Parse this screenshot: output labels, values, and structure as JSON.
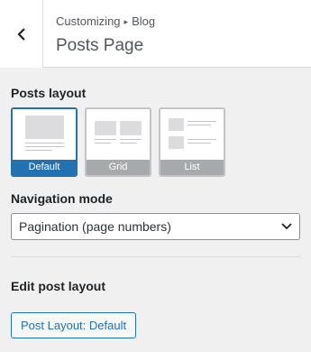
{
  "header": {
    "breadcrumb_parent": "Customizing",
    "breadcrumb_separator": "▸",
    "breadcrumb_current": "Blog",
    "title": "Posts Page"
  },
  "posts_layout": {
    "label": "Posts layout",
    "options": [
      {
        "label": "Default",
        "selected": true
      },
      {
        "label": "Grid",
        "selected": false
      },
      {
        "label": "List",
        "selected": false
      }
    ]
  },
  "navigation": {
    "label": "Navigation mode",
    "selected_value": "Pagination (page numbers)"
  },
  "post_layout": {
    "label": "Edit post layout",
    "button_label": "Post Layout: Default"
  },
  "colors": {
    "accent": "#2271b1",
    "background": "#f0f0f1",
    "inactive_caption": "#a7aaad"
  }
}
